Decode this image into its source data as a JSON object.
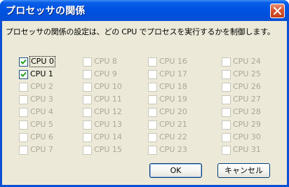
{
  "window": {
    "title": "プロセッサの関係"
  },
  "description": "プロセッサの関係の設定は、どの CPU でプロセスを実行するかを制御します。",
  "cpus": [
    {
      "label": "CPU 0",
      "checked": true,
      "enabled": true,
      "focused": true
    },
    {
      "label": "CPU 1",
      "checked": true,
      "enabled": true,
      "focused": false
    },
    {
      "label": "CPU 2",
      "checked": false,
      "enabled": false,
      "focused": false
    },
    {
      "label": "CPU 3",
      "checked": false,
      "enabled": false,
      "focused": false
    },
    {
      "label": "CPU 4",
      "checked": false,
      "enabled": false,
      "focused": false
    },
    {
      "label": "CPU 5",
      "checked": false,
      "enabled": false,
      "focused": false
    },
    {
      "label": "CPU 6",
      "checked": false,
      "enabled": false,
      "focused": false
    },
    {
      "label": "CPU 7",
      "checked": false,
      "enabled": false,
      "focused": false
    },
    {
      "label": "CPU 8",
      "checked": false,
      "enabled": false,
      "focused": false
    },
    {
      "label": "CPU 9",
      "checked": false,
      "enabled": false,
      "focused": false
    },
    {
      "label": "CPU 10",
      "checked": false,
      "enabled": false,
      "focused": false
    },
    {
      "label": "CPU 11",
      "checked": false,
      "enabled": false,
      "focused": false
    },
    {
      "label": "CPU 12",
      "checked": false,
      "enabled": false,
      "focused": false
    },
    {
      "label": "CPU 13",
      "checked": false,
      "enabled": false,
      "focused": false
    },
    {
      "label": "CPU 14",
      "checked": false,
      "enabled": false,
      "focused": false
    },
    {
      "label": "CPU 15",
      "checked": false,
      "enabled": false,
      "focused": false
    },
    {
      "label": "CPU 16",
      "checked": false,
      "enabled": false,
      "focused": false
    },
    {
      "label": "CPU 17",
      "checked": false,
      "enabled": false,
      "focused": false
    },
    {
      "label": "CPU 18",
      "checked": false,
      "enabled": false,
      "focused": false
    },
    {
      "label": "CPU 19",
      "checked": false,
      "enabled": false,
      "focused": false
    },
    {
      "label": "CPU 20",
      "checked": false,
      "enabled": false,
      "focused": false
    },
    {
      "label": "CPU 21",
      "checked": false,
      "enabled": false,
      "focused": false
    },
    {
      "label": "CPU 22",
      "checked": false,
      "enabled": false,
      "focused": false
    },
    {
      "label": "CPU 23",
      "checked": false,
      "enabled": false,
      "focused": false
    },
    {
      "label": "CPU 24",
      "checked": false,
      "enabled": false,
      "focused": false
    },
    {
      "label": "CPU 25",
      "checked": false,
      "enabled": false,
      "focused": false
    },
    {
      "label": "CPU 26",
      "checked": false,
      "enabled": false,
      "focused": false
    },
    {
      "label": "CPU 27",
      "checked": false,
      "enabled": false,
      "focused": false
    },
    {
      "label": "CPU 28",
      "checked": false,
      "enabled": false,
      "focused": false
    },
    {
      "label": "CPU 29",
      "checked": false,
      "enabled": false,
      "focused": false
    },
    {
      "label": "CPU 30",
      "checked": false,
      "enabled": false,
      "focused": false
    },
    {
      "label": "CPU 31",
      "checked": false,
      "enabled": false,
      "focused": false
    }
  ],
  "buttons": {
    "ok": "OK",
    "cancel": "キャンセル"
  },
  "colors": {
    "titlebar": "#0054e3",
    "client_background": "#ece9d8",
    "disabled_text": "#aca899",
    "checkbox_border": "#1c5180",
    "checkmark": "#21a121",
    "close_button": "#d9542e"
  },
  "icons": {
    "close": "close-x-icon",
    "check": "checkmark-icon"
  }
}
